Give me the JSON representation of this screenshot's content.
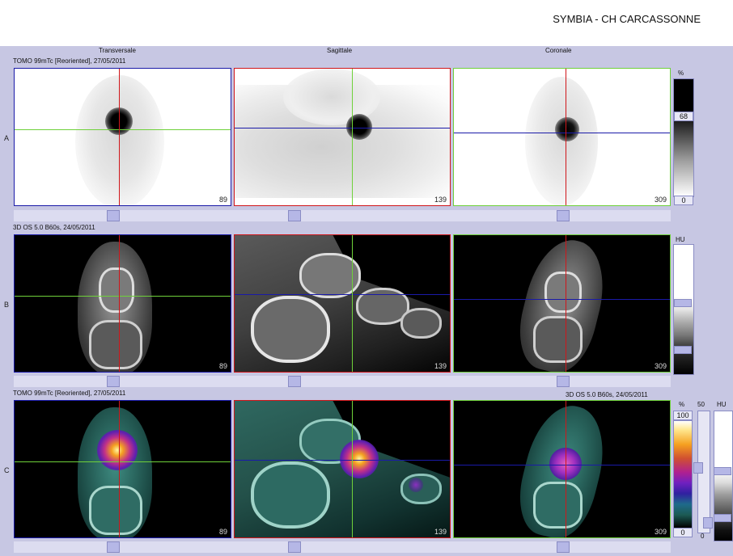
{
  "header": {
    "title": "SYMBIA - CH CARCASSONNE"
  },
  "columns": {
    "c1": "Transversale",
    "c2": "Sagittale",
    "c3": "Coronale"
  },
  "rows": {
    "a": {
      "label": "A",
      "series": "TOMO 99mTc [Reoriented], 27/05/2011"
    },
    "b": {
      "label": "B",
      "series": "3D  OS  5.0  B60s, 24/05/2011"
    },
    "c": {
      "label": "C",
      "series_left": "TOMO 99mTc [Reoriented], 27/05/2011",
      "series_right": "3D  OS  5.0  B60s, 24/05/2011"
    }
  },
  "slices": {
    "transversale": "89",
    "sagittale": "139",
    "coronale": "309"
  },
  "scales": {
    "a": {
      "unit": "%",
      "max": "68",
      "min": "0"
    },
    "b": {
      "unit": "HU"
    },
    "c": {
      "unit": "%",
      "max": "100",
      "min": "0",
      "mid": "50",
      "unit2": "HU",
      "min2": "0"
    }
  },
  "colors": {
    "crosshair_red": "#d0161a",
    "crosshair_green": "#6fd13a",
    "crosshair_blue": "#1a1aa8"
  }
}
